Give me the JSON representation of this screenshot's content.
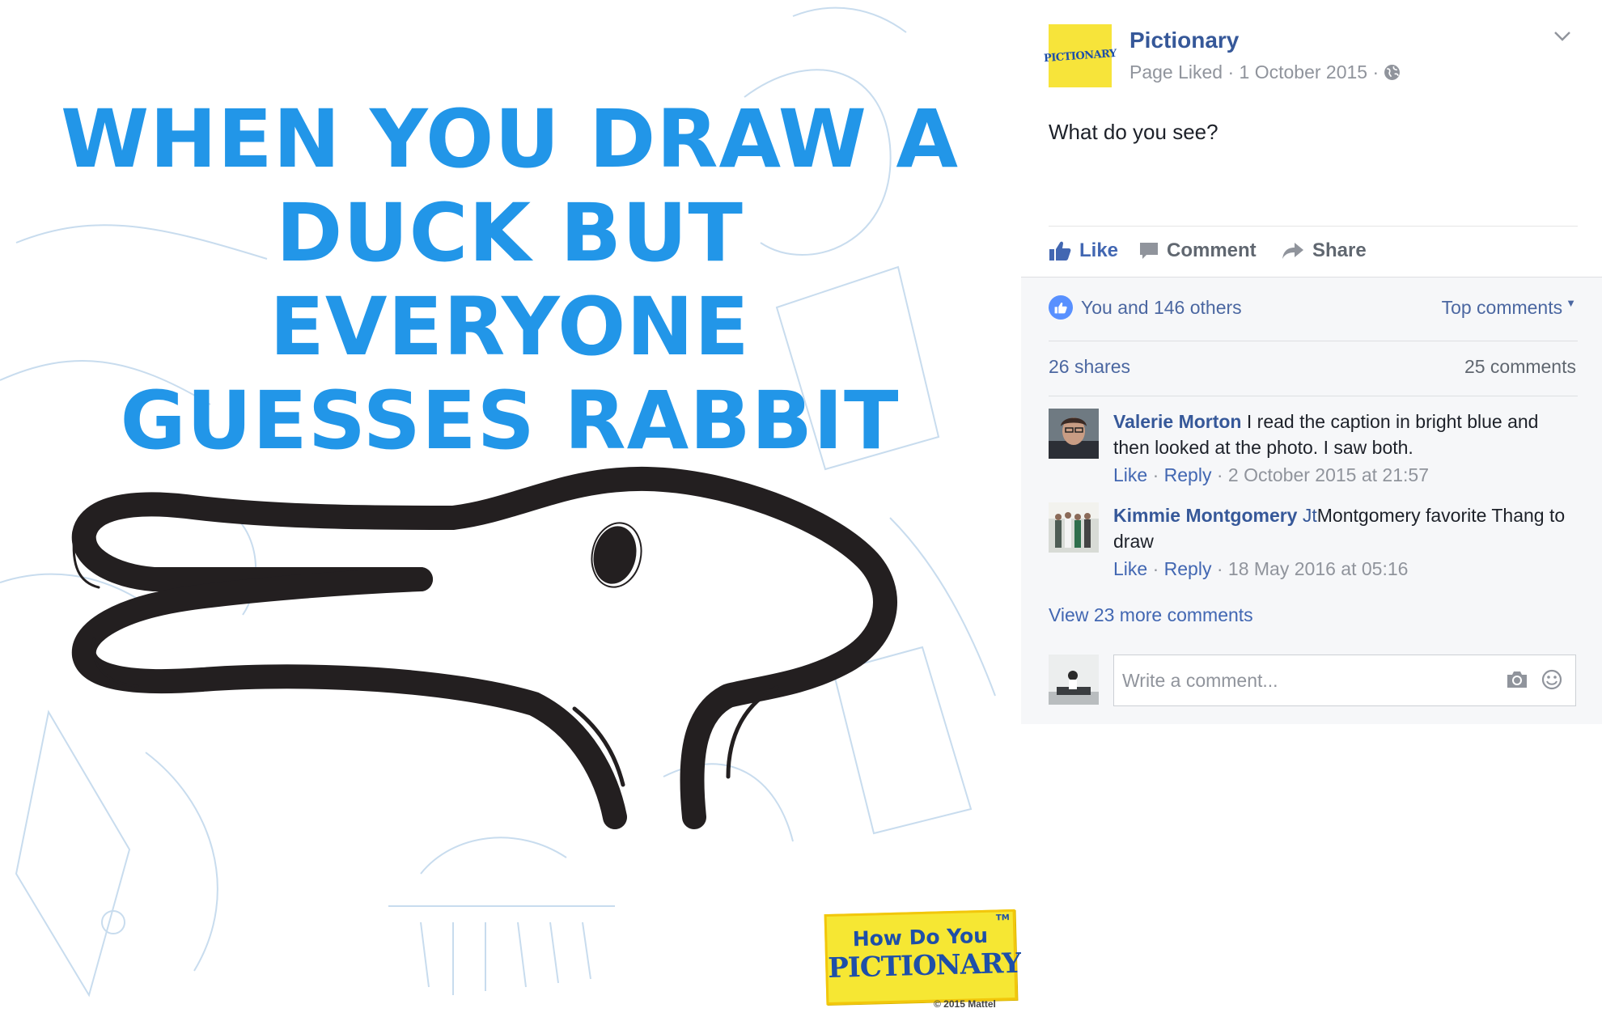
{
  "photo": {
    "caption_lines": [
      "WHEN YOU DRAW A",
      "DUCK BUT EVERYONE",
      "GUESSES RABBIT"
    ],
    "logo_line1": "How Do You",
    "logo_line2": "PICTIONARY?",
    "logo_tm": "TM",
    "copyright": "© 2015 Mattel"
  },
  "post": {
    "page_avatar_text": "PICTIONARY",
    "page_name": "Pictionary",
    "meta": "Page Liked · 1 October 2015 ·",
    "text": "What do you see?"
  },
  "actions": {
    "like": "Like",
    "comment": "Comment",
    "share": "Share"
  },
  "feedback": {
    "reactions": "You and 146 others",
    "top_comments": "Top comments",
    "shares": "26 shares",
    "comments_count": "25 comments",
    "view_more": "View 23 more comments",
    "composer_placeholder": "Write a comment..."
  },
  "comments": [
    {
      "author": "Valerie Morton",
      "text": "I read the caption in bright blue and then looked at the photo. I saw both.",
      "like": "Like",
      "reply": "Reply",
      "time": "2 October 2015 at 21:57"
    },
    {
      "author": "Kimmie Montgomery",
      "mention": "Jt",
      "text": "Montgomery favorite Thang to draw",
      "like": "Like",
      "reply": "Reply",
      "time": "18 May 2016 at 05:16"
    }
  ],
  "colors": {
    "caption_blue": "#2296e8",
    "facebook_blue": "#365899",
    "logo_yellow": "#f6e733"
  }
}
